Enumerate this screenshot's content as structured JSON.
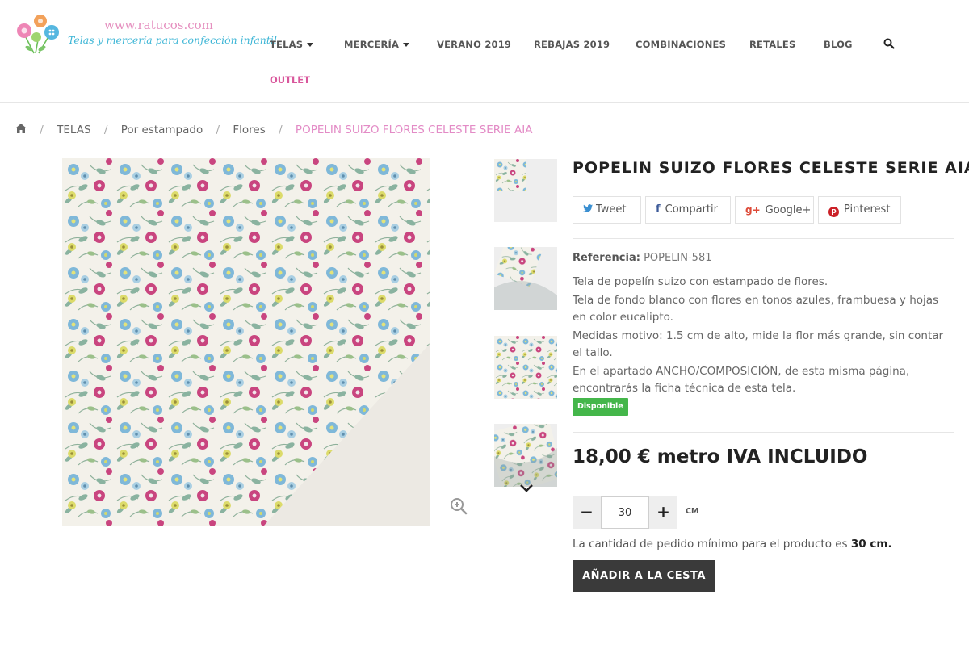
{
  "header": {
    "logo_url": "www.ratucos.com",
    "logo_tagline": "Telas y mercería para confección infantil",
    "nav": [
      {
        "label": "TELAS",
        "dropdown": true
      },
      {
        "label": "MERCERÍA",
        "dropdown": true
      },
      {
        "label": "VERANO 2019",
        "dropdown": false
      },
      {
        "label": "REBAJAS 2019",
        "dropdown": false
      },
      {
        "label": "COMBINACIONES",
        "dropdown": false
      },
      {
        "label": "RETALES",
        "dropdown": false
      },
      {
        "label": "BLOG",
        "dropdown": false
      }
    ],
    "outlet": "OUTLET",
    "search_icon": "search-icon"
  },
  "breadcrumb": {
    "home_icon": "home-icon",
    "items": [
      "TELAS",
      "Por estampado",
      "Flores"
    ],
    "current": "POPELIN SUIZO FLORES CELESTE SERIE AIA"
  },
  "product": {
    "title": "POPELIN SUIZO FLORES CELESTE SERIE AIA",
    "share": [
      {
        "label": "Tweet",
        "icon": "twitter-icon"
      },
      {
        "label": "Compartir",
        "icon": "facebook-icon"
      },
      {
        "label": "Google+",
        "icon": "googleplus-icon"
      },
      {
        "label": "Pinterest",
        "icon": "pinterest-icon"
      }
    ],
    "reference_label": "Referencia:",
    "reference_value": "POPELIN-581",
    "description": [
      "Tela de popelín suizo con estampado de flores.",
      "Tela de fondo blanco con flores en tonos azules, frambuesa y hojas en color eucalipto.",
      "Medidas motivo: 1.5 cm de alto, mide la flor más grande, sin contar el tallo.",
      "En el apartado ANCHO/COMPOSICIÓN, de esta misma página, encontrarás la ficha técnica de esta tela."
    ],
    "availability": "Disponible",
    "price": "18,00 € metro IVA INCLUIDO",
    "quantity": {
      "minus": "−",
      "value": "30",
      "plus": "+",
      "unit": "CM"
    },
    "min_note_prefix": "La cantidad de pedido mínimo para el producto es",
    "min_note_value": "30 cm.",
    "add_to_cart": "AÑADIR A LA CESTA"
  },
  "colors": {
    "accent_pink": "#d9579c",
    "breadcrumb_current": "#e38bc6",
    "available_green": "#44b64a",
    "button_dark": "#3a3a3a",
    "tagline_blue": "#3eb6d6"
  }
}
